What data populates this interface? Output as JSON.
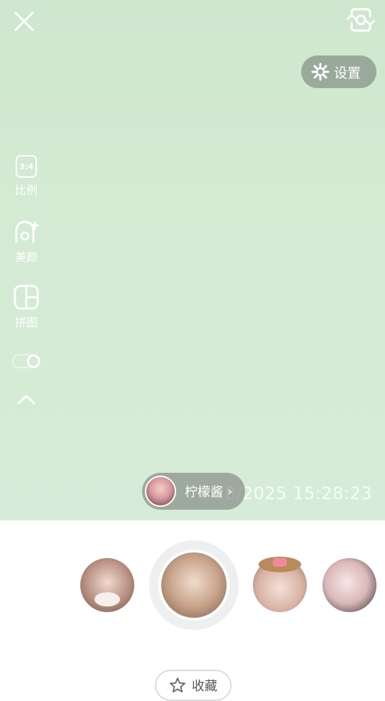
{
  "top": {
    "close_icon": "close-icon",
    "flip_icon": "camera-flip-icon"
  },
  "settings": {
    "label": "设置",
    "icon": "gear-icon"
  },
  "side_tools": [
    {
      "icon_text": "3:4",
      "label": "比例",
      "icon": "aspect-ratio-icon"
    },
    {
      "label": "美颜",
      "icon": "beauty-icon"
    },
    {
      "label": "拼图",
      "icon": "collage-icon"
    },
    {
      "icon": "toggle-icon"
    },
    {
      "icon": "chevron-up-icon"
    }
  ],
  "watermark": {
    "timestamp": "28/2025 15:28:23"
  },
  "creator": {
    "name": "柠檬酱"
  },
  "filters": [
    {
      "name": "filter-1",
      "selected": false
    },
    {
      "name": "filter-2",
      "selected": true
    },
    {
      "name": "filter-3",
      "selected": false
    },
    {
      "name": "filter-4",
      "selected": false
    }
  ],
  "favorite": {
    "label": "收藏",
    "icon": "star-icon"
  }
}
